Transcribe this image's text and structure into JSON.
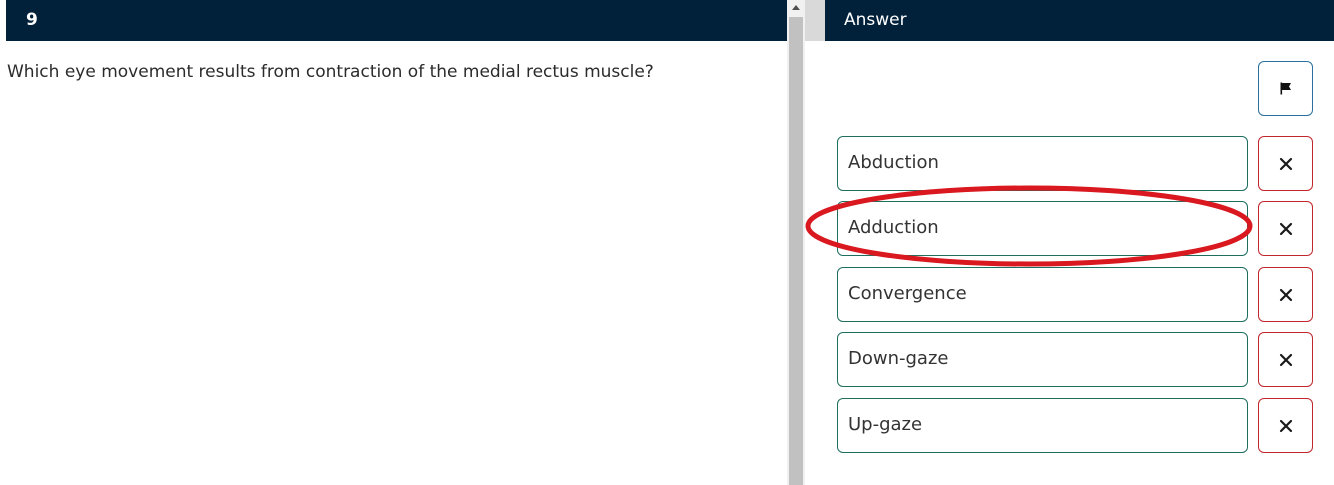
{
  "question": {
    "number": "9",
    "text": "Which eye movement results from contraction of the medial rectus muscle?"
  },
  "answer_panel": {
    "title": "Answer",
    "flag_icon": "flag-icon",
    "options": [
      {
        "label": "Abduction",
        "strike_icon": "close-icon"
      },
      {
        "label": "Adduction",
        "strike_icon": "close-icon",
        "highlighted": true
      },
      {
        "label": "Convergence",
        "strike_icon": "close-icon"
      },
      {
        "label": "Down-gaze",
        "strike_icon": "close-icon"
      },
      {
        "label": "Up-gaze",
        "strike_icon": "close-icon"
      }
    ]
  },
  "colors": {
    "header_bg": "#01203a",
    "option_border": "#1e6e5e",
    "strike_border": "#c0282d",
    "flag_border": "#2a6f9e",
    "annotation": "#d9191f"
  }
}
